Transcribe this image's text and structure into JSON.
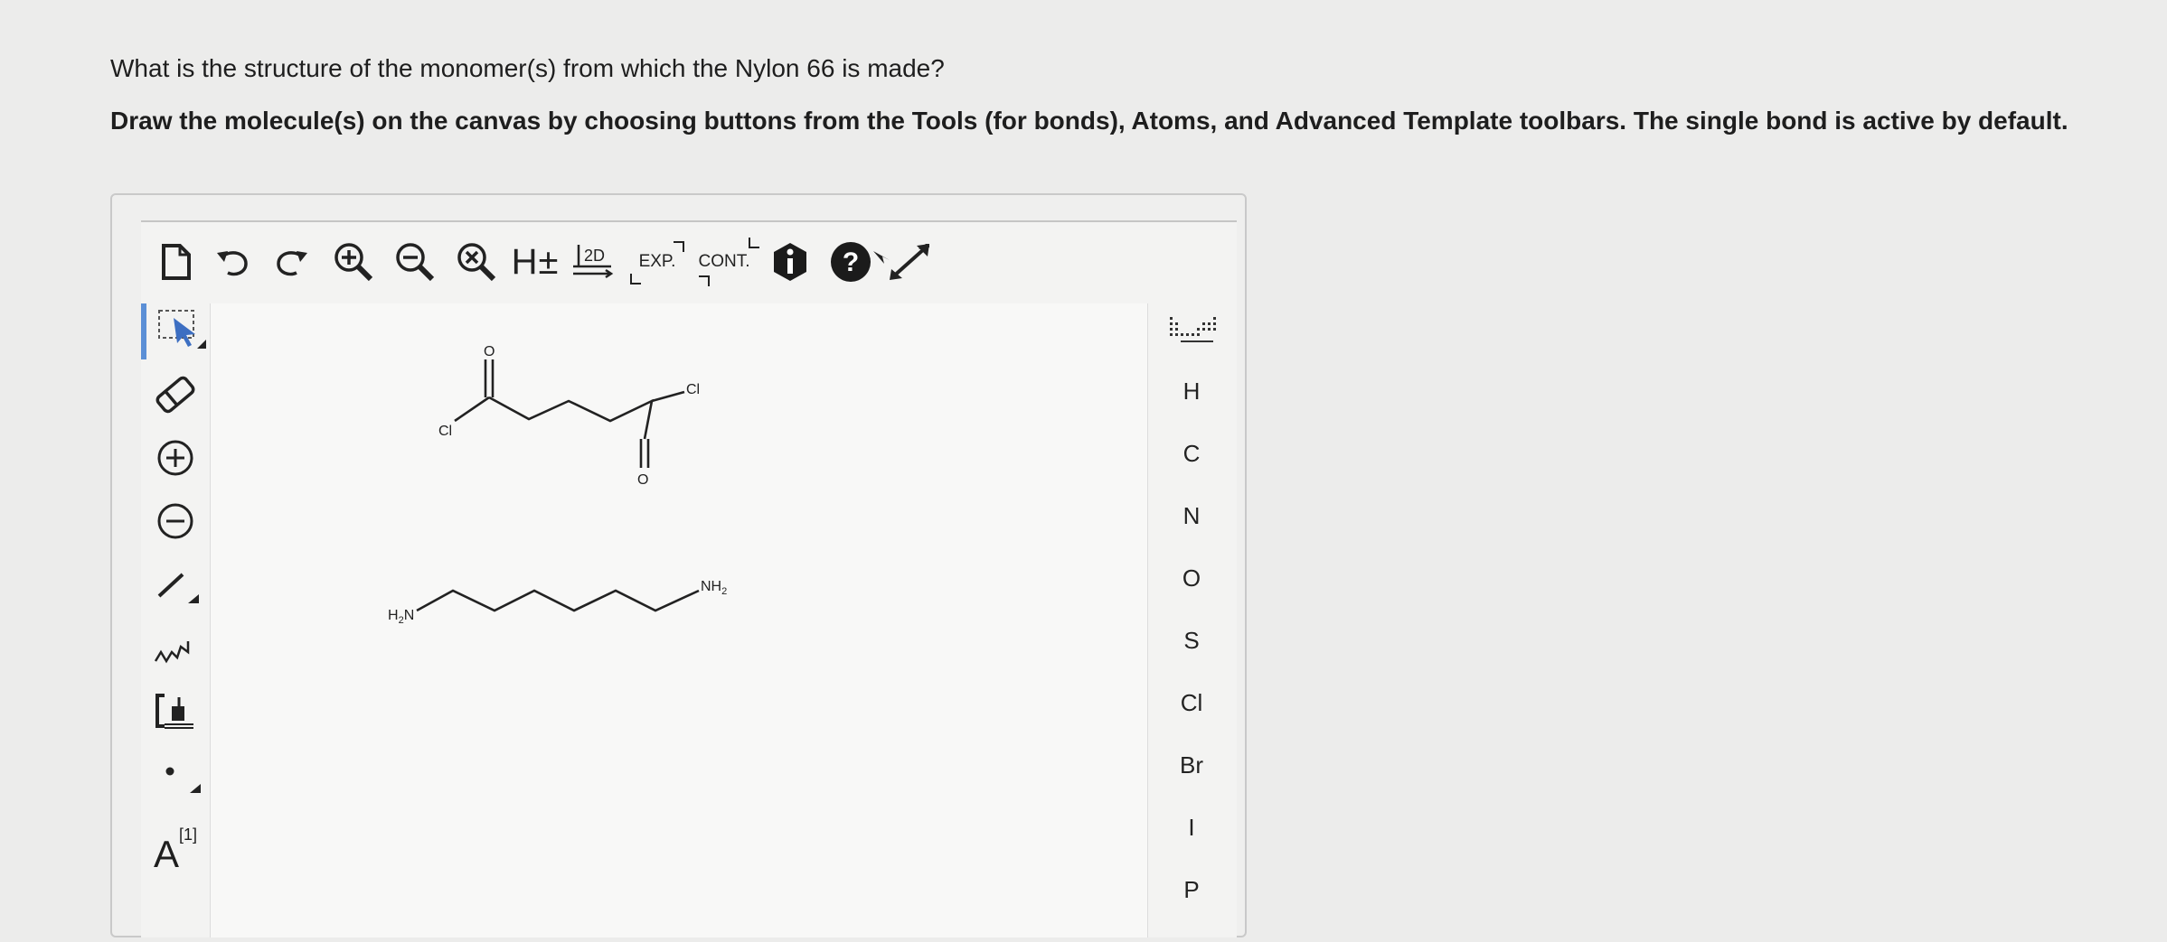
{
  "question": "What is the structure of the monomer(s) from which the Nylon 66 is made?",
  "instructions": "Draw the molecule(s) on the canvas by choosing buttons from the Tools (for bonds), Atoms, and Advanced Template toolbars. The single bond is active by default.",
  "top_toolbar": {
    "hydrogen_label": "H±",
    "layout_label": "2D",
    "expand_label": "EXP.",
    "contract_label": "CONT."
  },
  "left_toolbar": {
    "atom_mapping_label": "A",
    "atom_mapping_index": "[1]"
  },
  "atoms": [
    "H",
    "C",
    "N",
    "O",
    "S",
    "Cl",
    "Br",
    "I",
    "P"
  ],
  "molecules": {
    "adipoyl_chloride": {
      "o_top": "O",
      "cl_left": "Cl",
      "cl_right": "Cl",
      "o_bottom": "O"
    },
    "hexamethylenediamine": {
      "left_amine": "H",
      "left_amine_sub": "2",
      "left_amine_n": "N",
      "right_amine": "NH",
      "right_amine_sub": "2"
    }
  }
}
